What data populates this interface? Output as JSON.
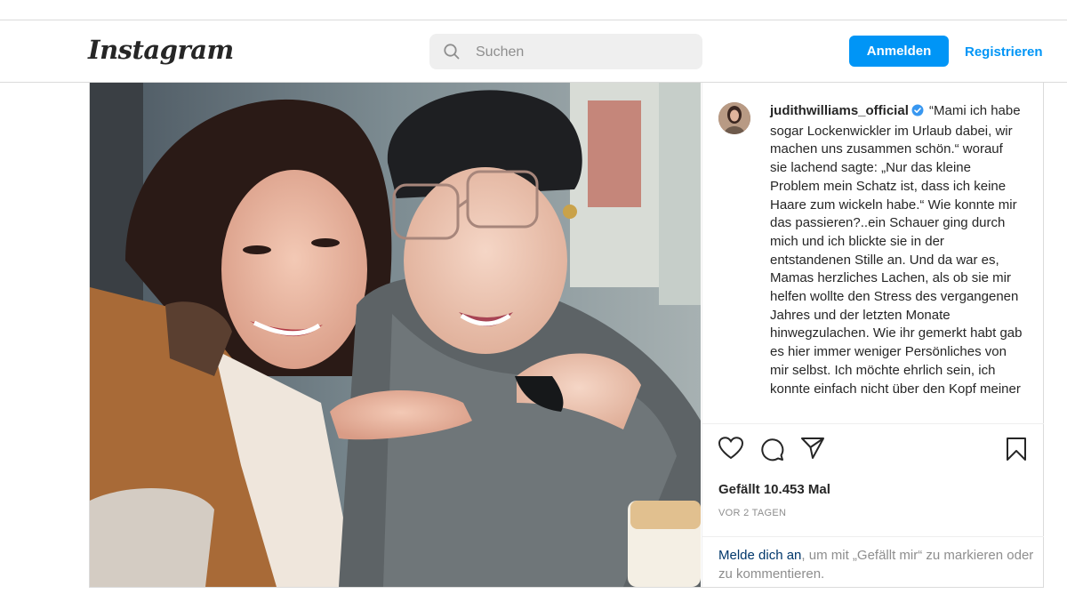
{
  "header": {
    "logo": "Instagram",
    "search_placeholder": "Suchen",
    "login_label": "Anmelden",
    "register_label": "Registrieren"
  },
  "post": {
    "username": "judithwilliams_official",
    "verified": true,
    "caption_text": "“Mami ich habe sogar Lockenwickler im Urlaub dabei, wir machen uns zusammen schön.“ worauf sie lachend sagte: „Nur das kleine Problem mein Schatz ist, dass ich keine Haare zum wickeln habe.“ Wie konnte mir das passieren?..ein Schauer ging durch mich und ich blickte sie in der entstandenen Stille an. Und da war es, Mamas herzliches Lachen, als ob sie mir helfen wollte den Stress des vergangenen Jahres und der letzten Monate hinwegzulachen. Wie ihr gemerkt habt gab es hier immer weniger Persönliches von mir selbst. Ich möchte ehrlich sein, ich konnte einfach nicht über den Kopf meiner",
    "likes": "Gefällt 10.453 Mal",
    "timestamp": "VOR 2 TAGEN",
    "login_prompt": {
      "link": "Melde dich an",
      "text": ", um mit „Gefällt mir“ zu markieren oder zu kommentieren."
    },
    "actions": {
      "like_icon": "heart-icon",
      "comment_icon": "comment-icon",
      "share_icon": "share-icon",
      "save_icon": "bookmark-icon"
    }
  },
  "colors": {
    "accent": "#0095f6",
    "link_dark": "#00376b",
    "verified": "#3897f0",
    "muted": "#8e8e8e",
    "border": "#dbdbdb"
  }
}
